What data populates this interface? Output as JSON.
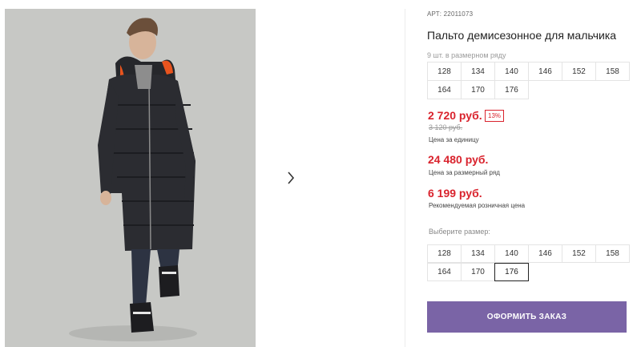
{
  "product": {
    "article": "АРТ: 22011073",
    "title": "Пальто демисезонное для мальчика",
    "pack_note": "9 шт. в размерном ряду",
    "pack_sizes": [
      "128",
      "134",
      "140",
      "146",
      "152",
      "158",
      "164",
      "170",
      "176"
    ]
  },
  "pricing": {
    "unit_price": "2 720 руб.",
    "discount": "13%",
    "old_price": "3 120 руб.",
    "unit_caption": "Цена за единицу",
    "pack_price": "24 480 руб.",
    "pack_caption": "Цена за размерный ряд",
    "retail_price": "6 199 руб.",
    "retail_caption": "Рекомендуемая розничная цена",
    "accent_color": "#d9232d"
  },
  "size_selector": {
    "label": "Выберите размер:",
    "sizes": [
      "128",
      "134",
      "140",
      "146",
      "152",
      "158",
      "164",
      "170",
      "176"
    ],
    "selected": "176"
  },
  "actions": {
    "order_label": "ОФОРМИТЬ ЗАКАЗ",
    "button_color": "#7a64a6"
  },
  "gallery": {
    "next_icon": "chevron-right-icon"
  }
}
